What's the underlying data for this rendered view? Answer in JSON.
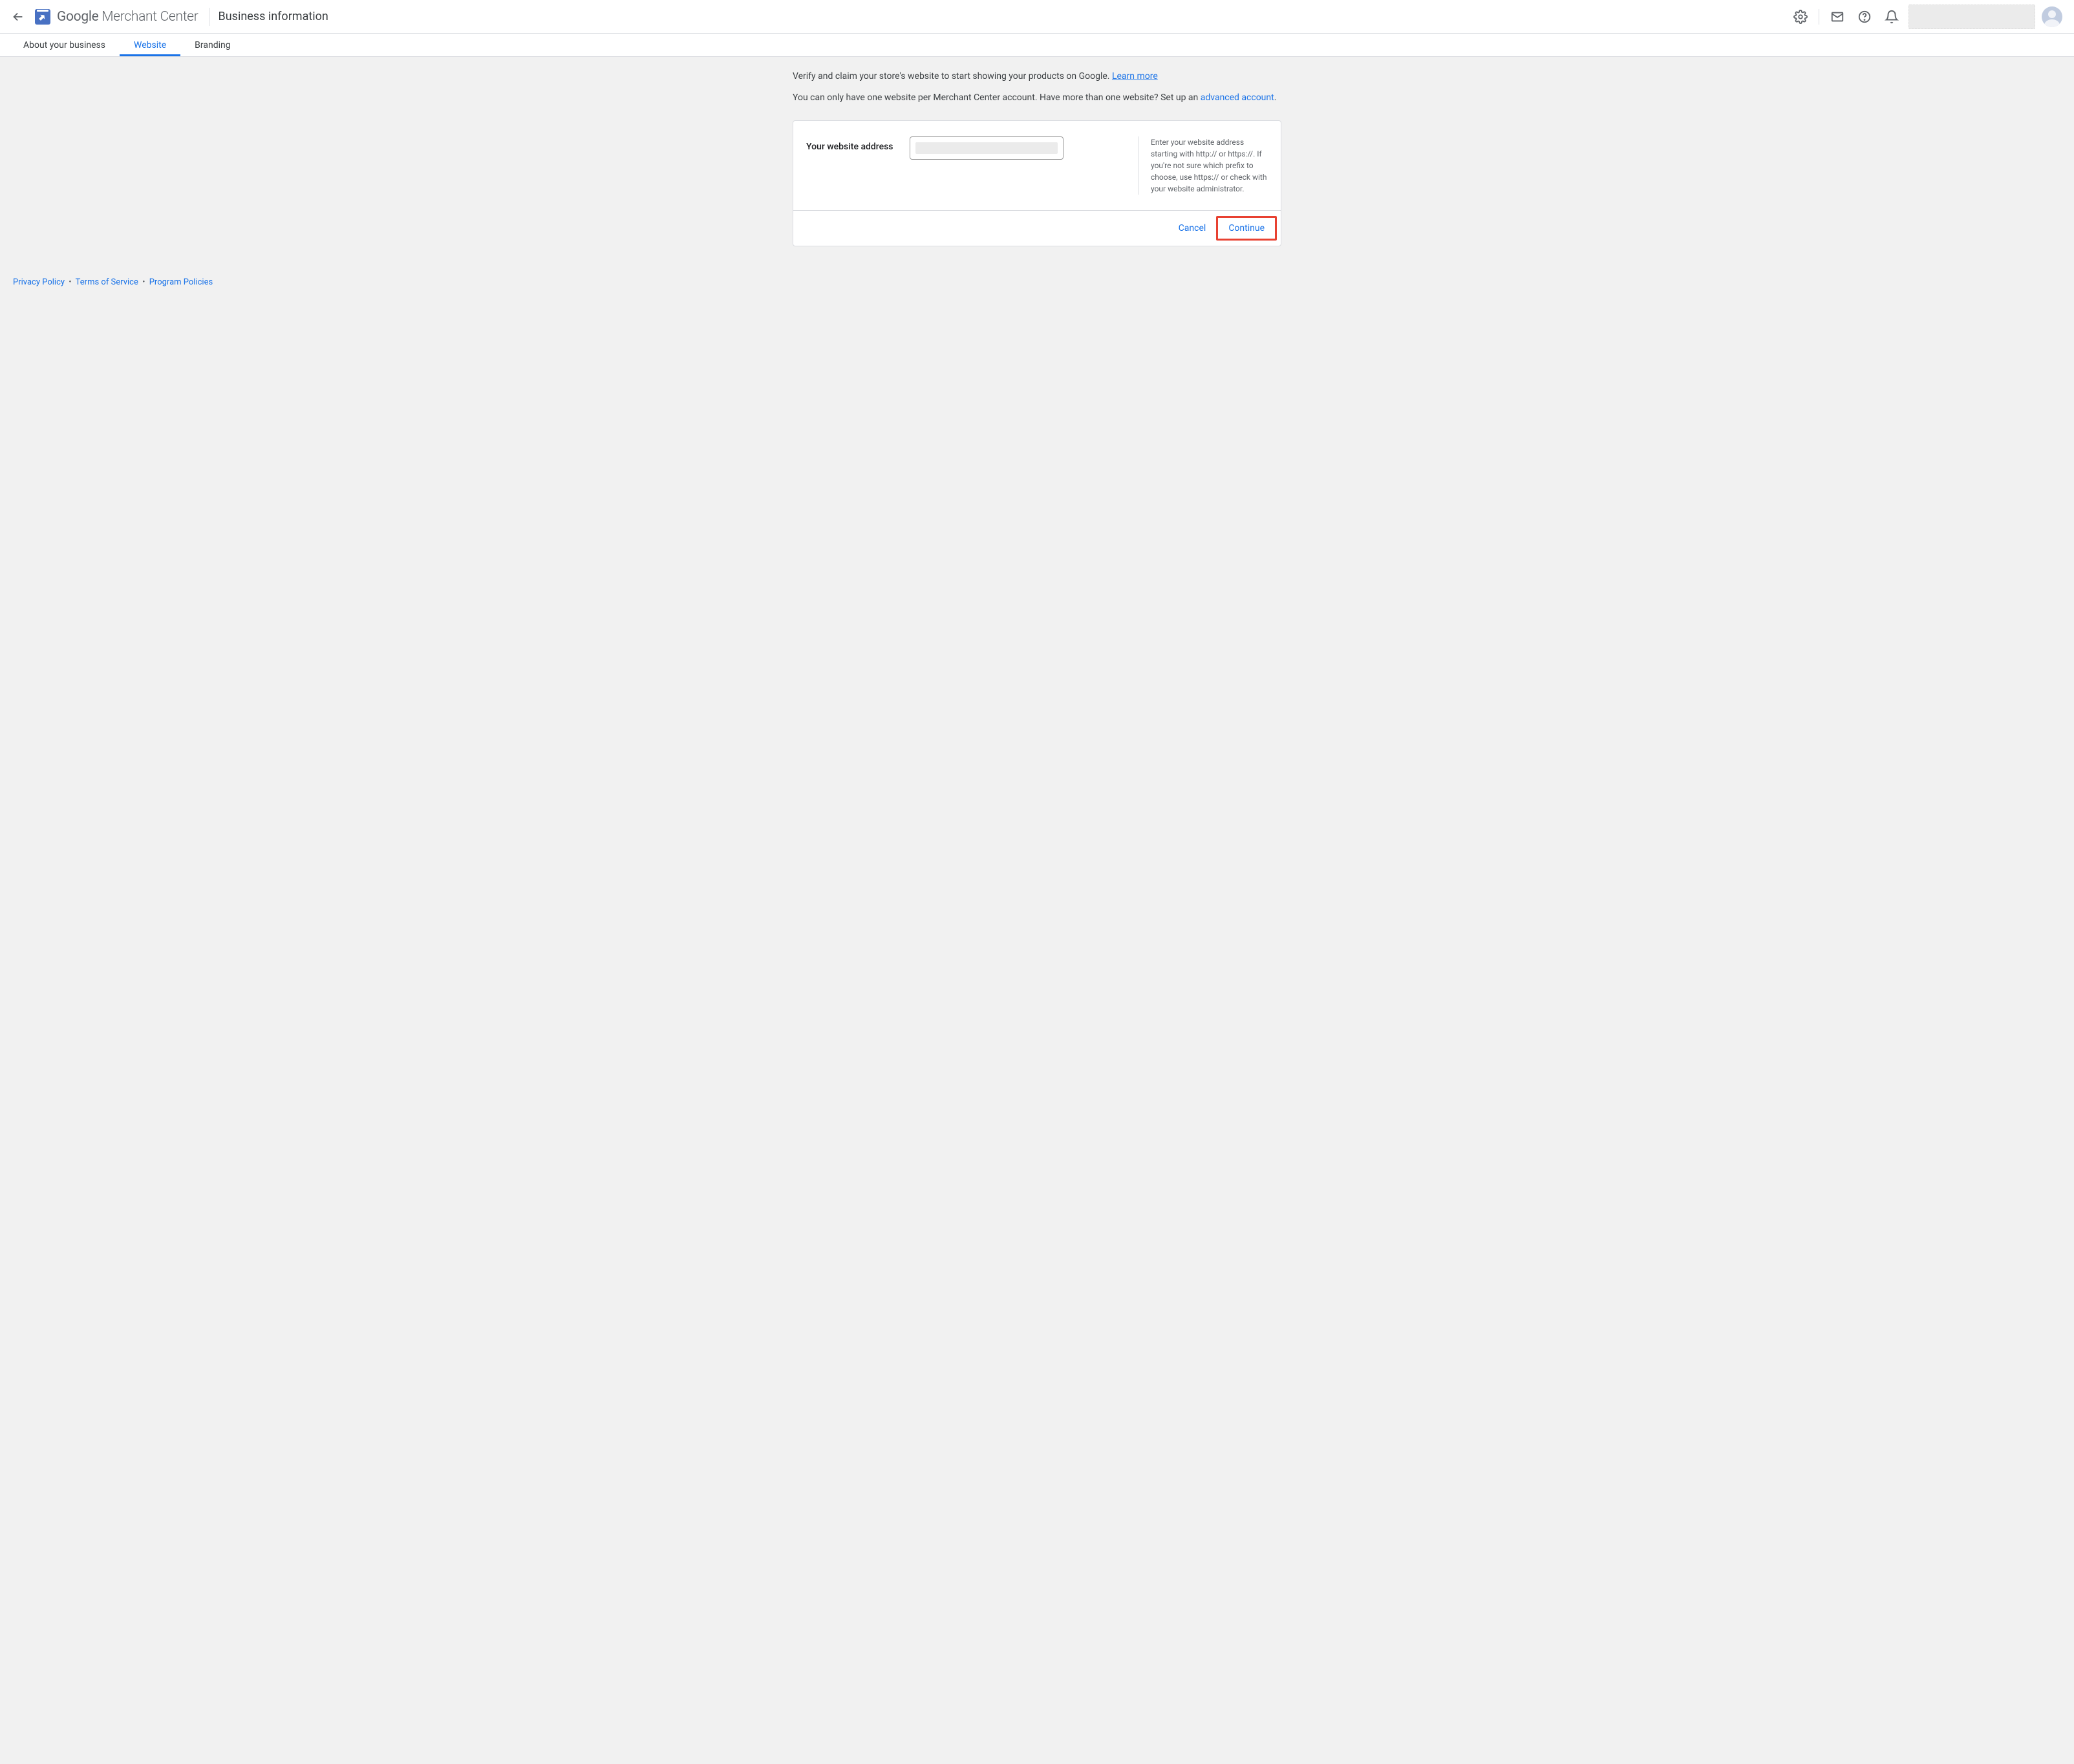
{
  "header": {
    "logo_prefix": "Google",
    "logo_suffix": " Merchant Center",
    "page_title": "Business information"
  },
  "tabs": [
    {
      "label": "About your business",
      "active": false
    },
    {
      "label": "Website",
      "active": true
    },
    {
      "label": "Branding",
      "active": false
    }
  ],
  "intro": {
    "line1_text": "Verify and claim your store's website to start showing your products on Google. ",
    "line1_link": "Learn more",
    "line2_pre": "You can only have one website per Merchant Center account. Have more than one website? Set up an ",
    "line2_link": "advanced account",
    "line2_post": "."
  },
  "form": {
    "label": "Your website address",
    "help": "Enter your website address starting with http:// or https://. If you're not sure which prefix to choose, use https:// or check with your website administrator."
  },
  "actions": {
    "cancel": "Cancel",
    "continue": "Continue"
  },
  "footer": {
    "privacy": "Privacy Policy",
    "terms": "Terms of Service",
    "policies": "Program Policies"
  }
}
